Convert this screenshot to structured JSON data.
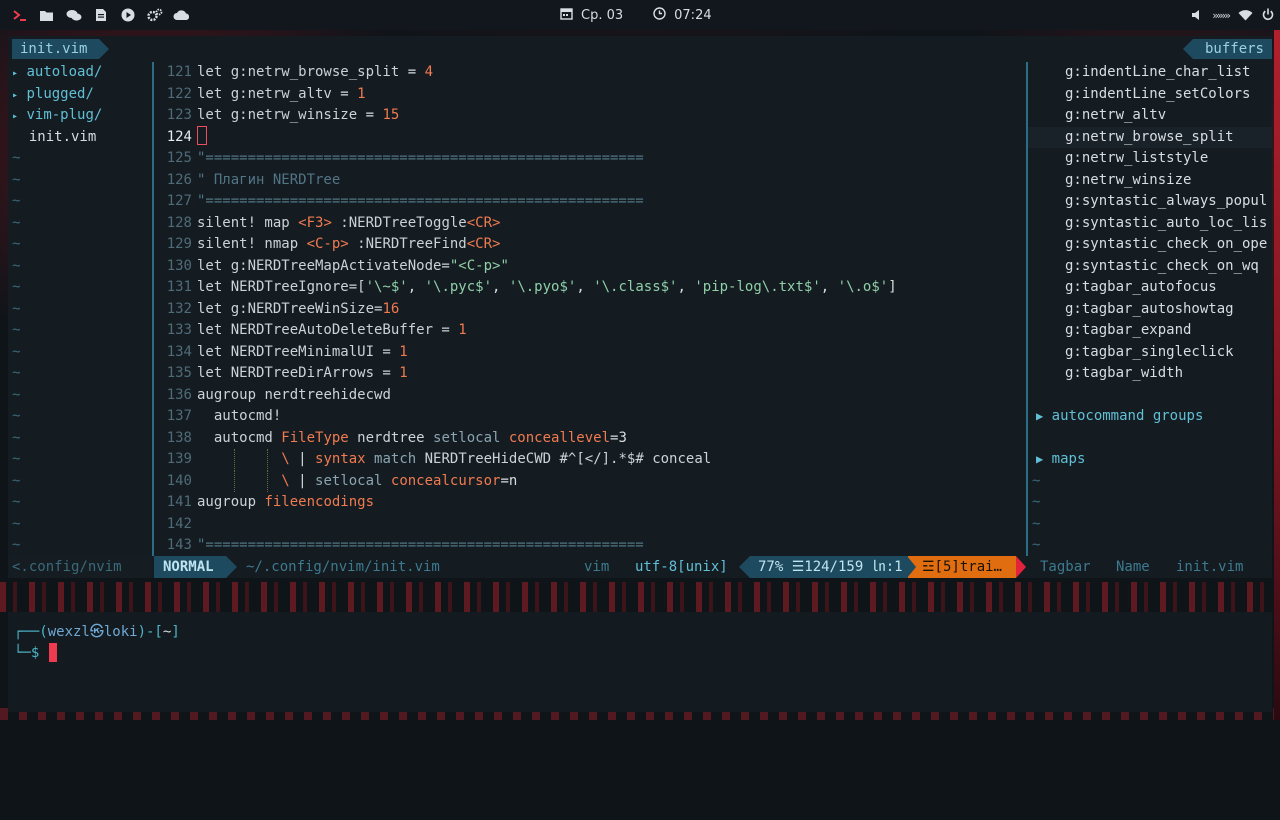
{
  "topbar": {
    "icons": [
      "terminal-icon",
      "folder-icon",
      "chat-icon",
      "document-icon",
      "play-icon",
      "settings-cogs-icon",
      "cloud-icon"
    ],
    "date": "Ср. 03",
    "time": "07:24",
    "tray_chevrons": "›››››››"
  },
  "tabline": {
    "file_tab": "init.vim",
    "buffers_tab": "buffers"
  },
  "tree": {
    "items": [
      "autoload/",
      "plugged/",
      "vim-plug/",
      "init.vim"
    ],
    "tilde": "~"
  },
  "editor": {
    "lines": [
      {
        "n": "121",
        "text": "let g:netrw_browse_split = 4"
      },
      {
        "n": "122",
        "text": "let g:netrw_altv = 1"
      },
      {
        "n": "123",
        "text": "let g:netrw_winsize = 15"
      },
      {
        "n": "124",
        "text": ""
      },
      {
        "n": "125",
        "text": "\"===================================================="
      },
      {
        "n": "126",
        "text": "\" Плагин NERDTree"
      },
      {
        "n": "127",
        "text": "\"===================================================="
      },
      {
        "n": "128",
        "text": "silent! map <F3> :NERDTreeToggle<CR>"
      },
      {
        "n": "129",
        "text": "silent! nmap <C-p> :NERDTreeFind<CR>"
      },
      {
        "n": "130",
        "text": "let g:NERDTreeMapActivateNode=\"<C-p>\""
      },
      {
        "n": "131",
        "text": "let NERDTreeIgnore=['\\~$', '\\.pyc$', '\\.pyo$', '\\.class$', 'pip-log\\.txt$', '\\.o$']"
      },
      {
        "n": "132",
        "text": "let g:NERDTreeWinSize=16"
      },
      {
        "n": "133",
        "text": "let NERDTreeAutoDeleteBuffer = 1"
      },
      {
        "n": "134",
        "text": "let NERDTreeMinimalUI = 1"
      },
      {
        "n": "135",
        "text": "let NERDTreeDirArrows = 1"
      },
      {
        "n": "136",
        "text": "augroup nerdtreehidecwd"
      },
      {
        "n": "137",
        "text": "  autocmd!"
      },
      {
        "n": "138",
        "text": "  autocmd FileType nerdtree setlocal conceallevel=3"
      },
      {
        "n": "139",
        "text": "          \\ | syntax match NERDTreeHideCWD #^[</].*$# conceal"
      },
      {
        "n": "140",
        "text": "          \\ | setlocal concealcursor=n"
      },
      {
        "n": "141",
        "text": "augroup fileencodings"
      },
      {
        "n": "142",
        "text": ""
      },
      {
        "n": "143",
        "text": "\"===================================================="
      }
    ],
    "current_line": "124"
  },
  "tagbar": {
    "tags": [
      "g:indentLine_char_list",
      "g:indentLine_setColors",
      "g:netrw_altv",
      "g:netrw_browse_split",
      "g:netrw_liststyle",
      "g:netrw_winsize",
      "g:syntastic_always_popul",
      "g:syntastic_auto_loc_lis",
      "g:syntastic_check_on_ope",
      "g:syntastic_check_on_wq",
      "g:tagbar_autofocus",
      "g:tagbar_autoshowtag",
      "g:tagbar_expand",
      "g:tagbar_singleclick",
      "g:tagbar_width"
    ],
    "highlighted_tag": "g:netrw_browse_split",
    "group1": "autocommand groups",
    "group2": "maps",
    "tilde": "~"
  },
  "statusline": {
    "tree": "<.config/nvim",
    "mode": "NORMAL",
    "path": "~/.config/nvim/init.vim",
    "filetype": "vim",
    "encoding": "utf-8[unix]",
    "position": "77% ☰124/159 ㏑:1",
    "warning": "☲[5]trai…",
    "tagbar": "Tagbar",
    "name": "Name",
    "file": "init.vim"
  },
  "terminal": {
    "prompt_corner": "┌──(",
    "user": "wexzl㉿loki",
    "mid": ")-[",
    "dir": "~",
    "end": "]",
    "prompt2": "└─$"
  },
  "colors": {
    "accent_teal": "#1d4a5e",
    "warning_orange": "#e06d10",
    "cursor_red": "#ef3b4f"
  }
}
